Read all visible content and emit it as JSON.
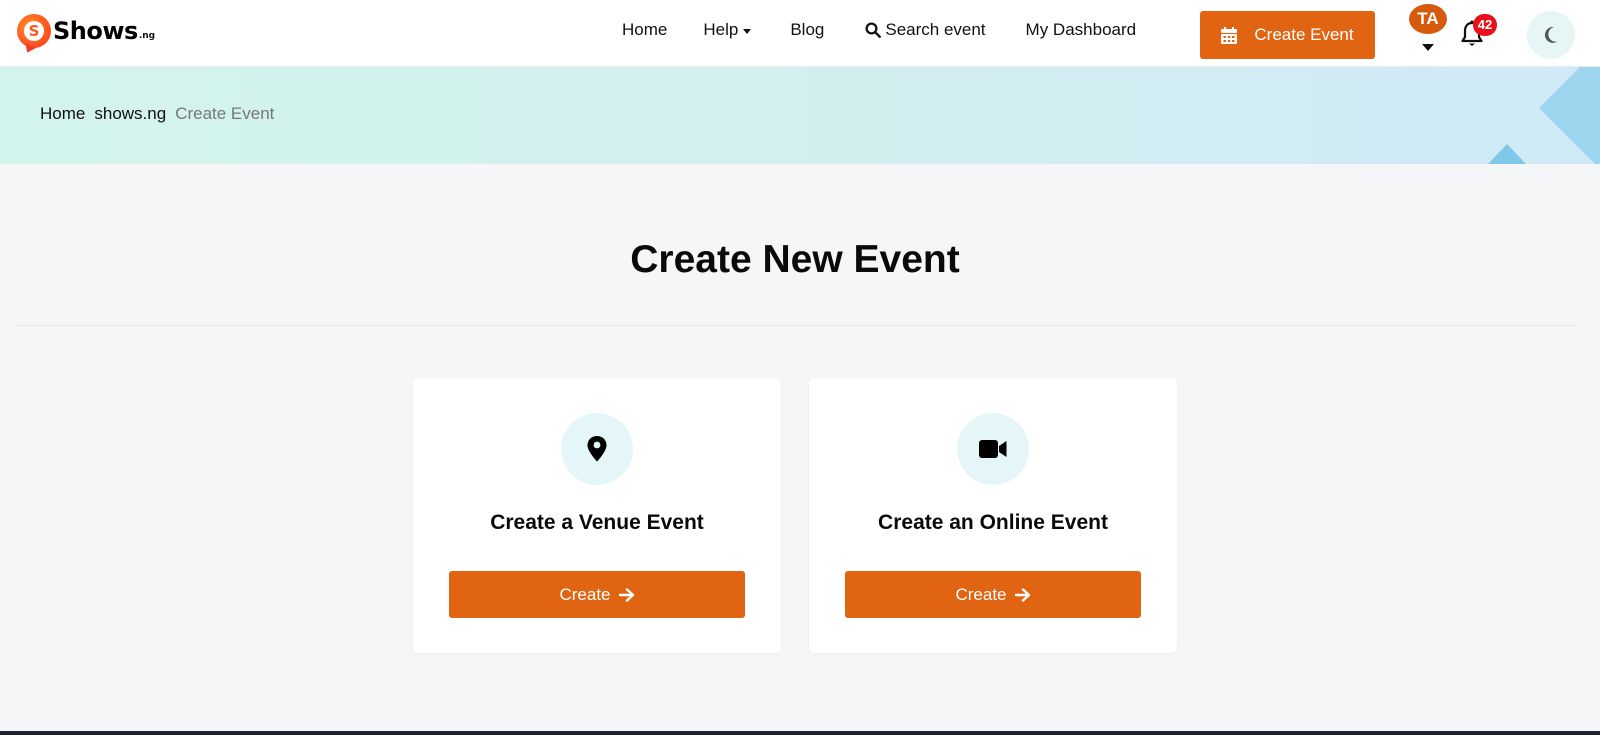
{
  "brand": {
    "logo_letter": "S",
    "name": "Shows",
    "tld": ".ng"
  },
  "nav": {
    "items": [
      {
        "label": "Home",
        "icon": null
      },
      {
        "label": "Help",
        "icon": "caret-down-icon"
      },
      {
        "label": "Blog",
        "icon": null
      },
      {
        "label": "Search event",
        "icon": "search-icon"
      },
      {
        "label": "My Dashboard",
        "icon": null
      }
    ]
  },
  "header_actions": {
    "create_event_label": "Create Event",
    "create_event_icon": "calendar-icon",
    "avatar_initials": "TA",
    "notification_count": "42",
    "theme_toggle_icon": "moon-icon"
  },
  "breadcrumb": {
    "items": [
      "Home",
      "shows.ng"
    ],
    "current": "Create Event"
  },
  "main": {
    "title": "Create New Event",
    "cards": [
      {
        "icon": "map-pin-icon",
        "title": "Create a Venue Event",
        "button_label": "Create"
      },
      {
        "icon": "video-camera-icon",
        "title": "Create an Online Event",
        "button_label": "Create"
      }
    ]
  },
  "colors": {
    "accent": "#e06411",
    "avatar": "#d65a0c",
    "badge": "#e8101b",
    "icon_circle": "#e5f6f8",
    "page_bg": "#f5f6f8",
    "footer": "#1b2331"
  }
}
